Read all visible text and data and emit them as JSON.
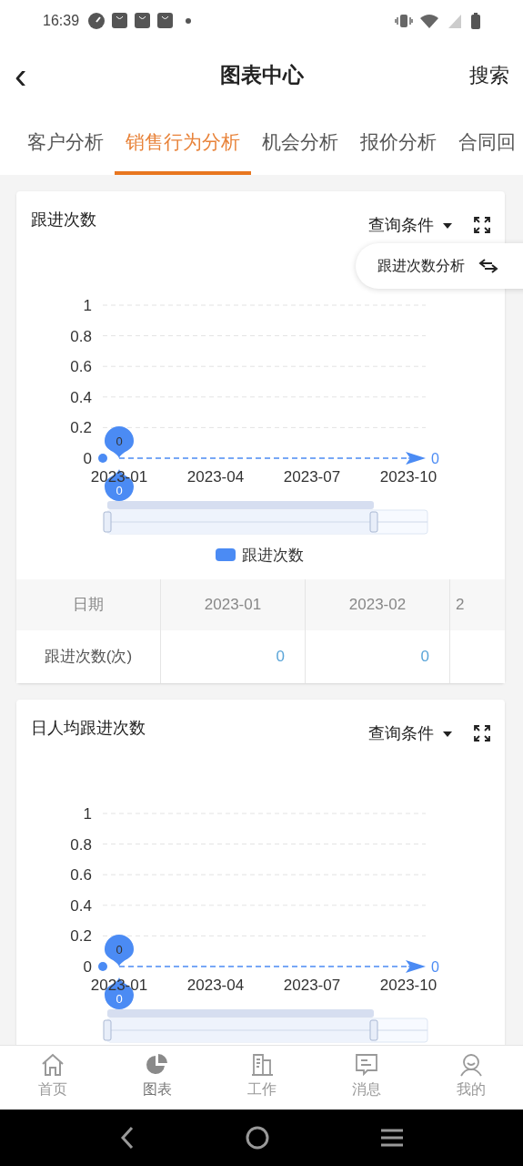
{
  "status_bar": {
    "time": "16:39"
  },
  "header": {
    "back": "‹",
    "title": "图表中心",
    "action": "搜索"
  },
  "tabs": [
    {
      "label": "客户分析",
      "selected": false
    },
    {
      "label": "销售行为分析",
      "selected": true
    },
    {
      "label": "机会分析",
      "selected": false
    },
    {
      "label": "报价分析",
      "selected": false
    },
    {
      "label": "合同回",
      "selected": false
    }
  ],
  "cards": [
    {
      "title": "跟进次数",
      "filter": "查询条件",
      "switch_label": "跟进次数分析",
      "chart_data": {
        "type": "line",
        "categories": [
          "2023-01",
          "2023-04",
          "2023-07",
          "2023-10"
        ],
        "series": [
          {
            "name": "跟进次数",
            "color": "#4b8bf4",
            "line_style": "dashed",
            "values": [
              0,
              0,
              0,
              0
            ]
          }
        ],
        "ylim": [
          0,
          1
        ],
        "yticks": [
          0,
          0.2,
          0.4,
          0.6,
          0.8,
          1
        ],
        "grid": true,
        "annotations": [
          {
            "text": "0",
            "x": "2023-01",
            "y": 0
          },
          {
            "text": "0",
            "x": "2023-01",
            "y": 0
          },
          {
            "text": "0",
            "x": "2023-10",
            "y": 0
          }
        ]
      },
      "table": {
        "columns": [
          "日期",
          "2023-01",
          "2023-02",
          "2"
        ],
        "rows": [
          {
            "label": "跟进次数(次)",
            "values": [
              "0",
              "0"
            ]
          }
        ]
      }
    },
    {
      "title": "日人均跟进次数",
      "filter": "查询条件",
      "chart_data": {
        "type": "line",
        "categories": [
          "2023-01",
          "2023-04",
          "2023-07",
          "2023-10"
        ],
        "series": [
          {
            "color": "#4b8bf4",
            "line_style": "dashed",
            "values": [
              0,
              0,
              0,
              0
            ]
          }
        ],
        "ylim": [
          0,
          1
        ],
        "yticks": [
          0,
          0.2,
          0.4,
          0.6,
          0.8,
          1
        ],
        "grid": true,
        "annotations": [
          {
            "text": "0",
            "x": "2023-01",
            "y": 0
          },
          {
            "text": "0",
            "x": "2023-01",
            "y": 0
          },
          {
            "text": "0",
            "x": "2023-10",
            "y": 0
          }
        ]
      }
    }
  ],
  "bottom_nav": [
    {
      "kind": "home",
      "label": "首页",
      "selected": false
    },
    {
      "kind": "chart",
      "label": "图表",
      "selected": true
    },
    {
      "kind": "work",
      "label": "工作",
      "selected": false
    },
    {
      "kind": "message",
      "label": "消息",
      "selected": false
    },
    {
      "kind": "profile",
      "label": "我的",
      "selected": false
    }
  ]
}
